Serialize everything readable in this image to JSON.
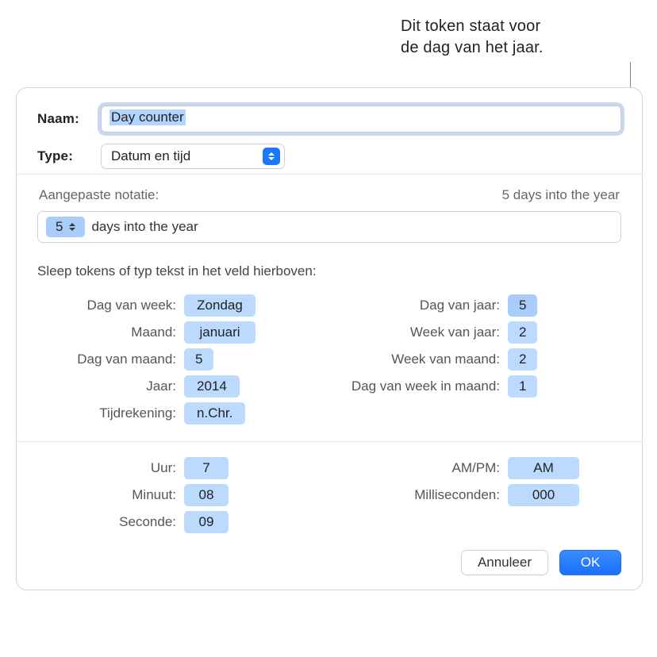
{
  "annotation": {
    "line1": "Dit token staat voor",
    "line2": "de dag van het jaar."
  },
  "form": {
    "name_label": "Naam:",
    "name_value": "Day counter",
    "type_label": "Type:",
    "type_value": "Datum en tijd"
  },
  "custom": {
    "heading": "Aangepaste notatie:",
    "preview": "5 days into the year",
    "token_value": "5",
    "token_suffix": "days into the year"
  },
  "hint": "Sleep tokens of typ tekst in het veld hierboven:",
  "tokens_date": {
    "left": [
      {
        "label": "Dag van week:",
        "value": "Zondag"
      },
      {
        "label": "Maand:",
        "value": "januari"
      },
      {
        "label": "Dag van maand:",
        "value": "5"
      },
      {
        "label": "Jaar:",
        "value": "2014"
      },
      {
        "label": "Tijdrekening:",
        "value": "n.Chr."
      }
    ],
    "right": [
      {
        "label": "Dag van jaar:",
        "value": "5"
      },
      {
        "label": "Week van jaar:",
        "value": "2"
      },
      {
        "label": "Week van maand:",
        "value": "2"
      },
      {
        "label": "Dag van week in maand:",
        "value": "1"
      }
    ]
  },
  "tokens_time": {
    "left": [
      {
        "label": "Uur:",
        "value": "7"
      },
      {
        "label": "Minuut:",
        "value": "08"
      },
      {
        "label": "Seconde:",
        "value": "09"
      }
    ],
    "right": [
      {
        "label": "AM/PM:",
        "value": "AM"
      },
      {
        "label": "Milliseconden:",
        "value": "000"
      }
    ]
  },
  "buttons": {
    "cancel": "Annuleer",
    "ok": "OK"
  }
}
